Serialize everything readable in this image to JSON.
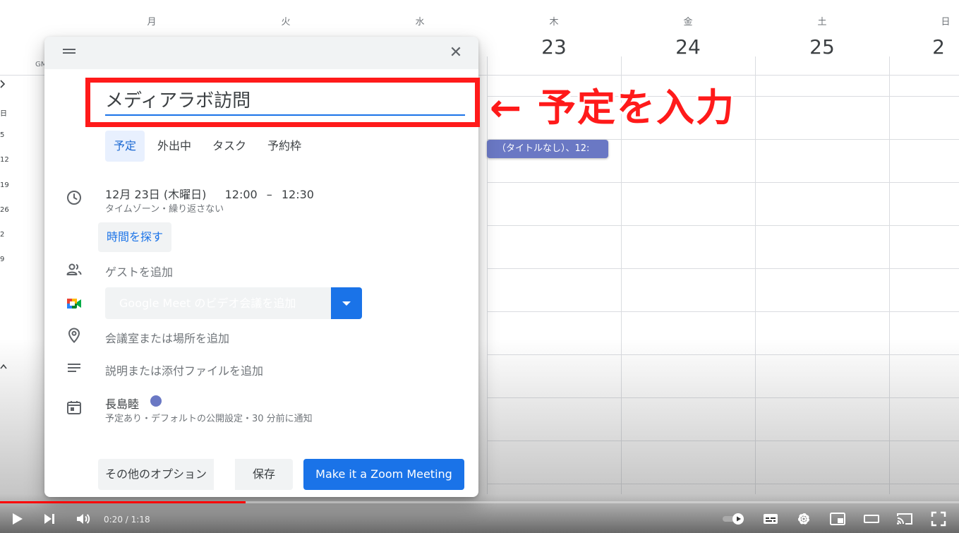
{
  "calendar": {
    "days": [
      {
        "name": "月",
        "num": ""
      },
      {
        "name": "火",
        "num": ""
      },
      {
        "name": "水",
        "num": ""
      },
      {
        "name": "木",
        "num": "23"
      },
      {
        "name": "金",
        "num": "24"
      },
      {
        "name": "土",
        "num": "25"
      },
      {
        "name": "日",
        "num": "2"
      }
    ],
    "gmt_label": "GM",
    "left_strip": [
      "日",
      "5",
      "12",
      "19",
      "26",
      "2",
      "9"
    ],
    "event_chip": "（タイトルなし）、12:"
  },
  "annotation": {
    "text": "← 予定を入力",
    "color": "#ff1a1a"
  },
  "dialog": {
    "title_value": "メディアラボ訪問",
    "tabs": [
      {
        "label": "予定",
        "active": true
      },
      {
        "label": "外出中",
        "active": false
      },
      {
        "label": "タスク",
        "active": false
      },
      {
        "label": "予約枠",
        "active": false
      }
    ],
    "datetime": {
      "date": "12月 23日 (木曜日)",
      "start": "12:00",
      "sep": "–",
      "end": "12:30",
      "sub": "タイムゾーン・繰り返さない"
    },
    "find_time": "時間を探す",
    "guests_placeholder": "ゲストを追加",
    "meet_label": "Google Meet のビデオ会議を追加",
    "location_placeholder": "会議室または場所を追加",
    "description_placeholder": "説明または添付ファイルを追加",
    "calendar_owner": "長島睦",
    "calendar_sub": "予定あり・デフォルトの公開設定・30 分前に通知",
    "more_options": "その他のオプション",
    "save": "保存",
    "zoom_button": "Make it a Zoom Meeting",
    "accent": "#1a73e8",
    "calendar_color": "#6a78c4"
  },
  "player": {
    "current": "0:20",
    "duration": "1:18",
    "time_sep": " / ",
    "progress": 0.2564
  }
}
